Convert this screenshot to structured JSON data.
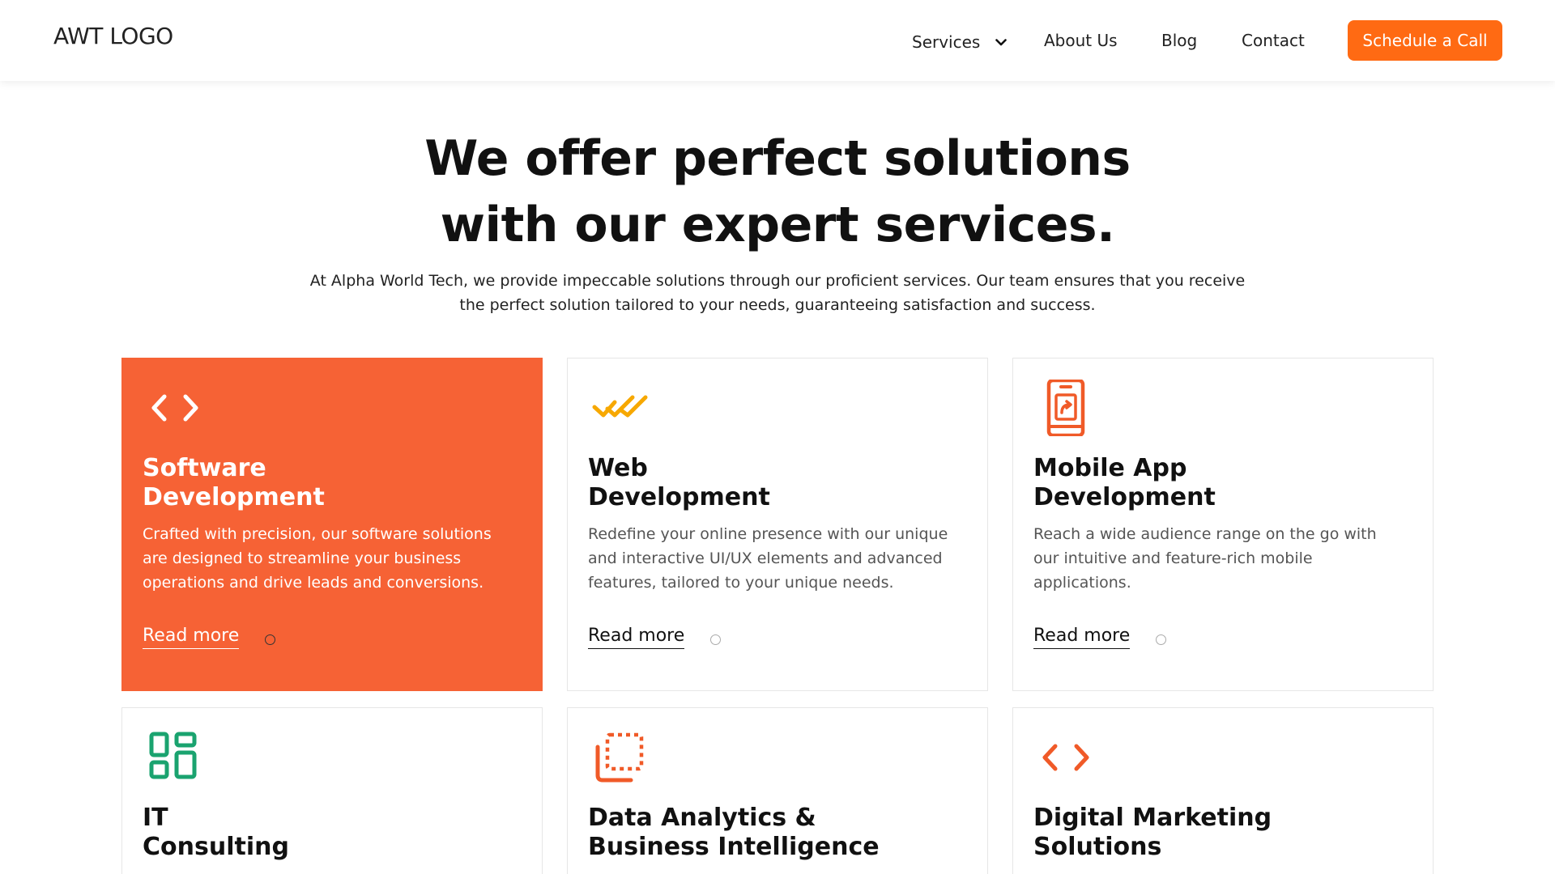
{
  "header": {
    "logo": "AWT LOGO",
    "nav": [
      {
        "label": "Services",
        "has_dropdown": true
      },
      {
        "label": "About Us"
      },
      {
        "label": "Blog"
      },
      {
        "label": "Contact"
      }
    ],
    "cta_label": "Schedule a Call"
  },
  "hero": {
    "title_line1": "We offer perfect solutions",
    "title_line2": "with our expert services.",
    "subtitle_line1": "At Alpha World Tech, we provide impeccable solutions through our proficient services. Our team ensures that you receive",
    "subtitle_line2": "the perfect solution tailored to your needs, guaranteeing satisfaction and success."
  },
  "colors": {
    "accent": "#ff6a13",
    "active_card": "#f66235",
    "icon_orange": "#f05a28",
    "icon_yellow": "#f7a800",
    "icon_green": "#1aa36f"
  },
  "services": [
    {
      "icon": "code-brackets-icon",
      "title_line1": "Software",
      "title_line2": "Development",
      "description": "Crafted with precision, our software solutions are designed to streamline your business operations and drive leads and conversions.",
      "read_more": "Read more",
      "active": true
    },
    {
      "icon": "double-check-icon",
      "title_line1": "Web",
      "title_line2": "Development",
      "description": "Redefine your online presence with our unique and interactive UI/UX elements and advanced features, tailored to your unique needs.",
      "read_more": "Read more",
      "active": false
    },
    {
      "icon": "mobile-share-icon",
      "title_line1": "Mobile App",
      "title_line2": "Development",
      "description": "Reach a wide audience range on the go with our intuitive and feature-rich mobile applications.",
      "read_more": "Read more",
      "active": false
    },
    {
      "icon": "dashboard-grid-icon",
      "title_line1": "IT",
      "title_line2": "Consulting",
      "active": false
    },
    {
      "icon": "data-frame-icon",
      "title_line1": "Data Analytics &",
      "title_line2": "Business Intelligence",
      "active": false
    },
    {
      "icon": "code-brackets-icon",
      "title_line1": "Digital Marketing",
      "title_line2": "Solutions",
      "active": false
    }
  ]
}
